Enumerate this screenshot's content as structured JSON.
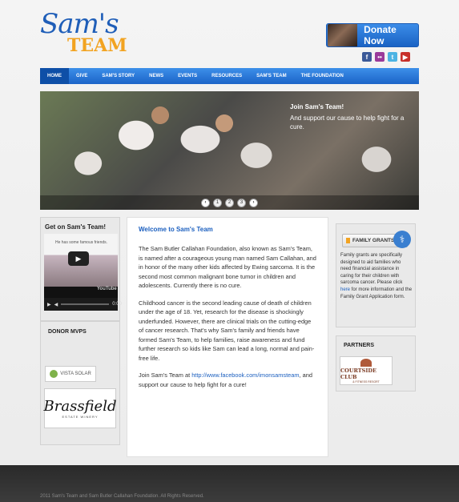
{
  "header": {
    "logo_script": "Sam's",
    "logo_team": "TEAM",
    "donate_label": "Donate Now",
    "social": [
      {
        "icon": "facebook-icon",
        "glyph": "f",
        "color": "#3b5998"
      },
      {
        "icon": "flickr-icon",
        "glyph": "••",
        "color": "#9a3a9a"
      },
      {
        "icon": "twitter-icon",
        "glyph": "t",
        "color": "#4cb3e3"
      },
      {
        "icon": "youtube-icon",
        "glyph": "▶",
        "color": "#c8302a"
      }
    ]
  },
  "nav": {
    "items": [
      "HOME",
      "GIVE",
      "SAM'S STORY",
      "NEWS",
      "EVENTS",
      "RESOURCES",
      "SAM'S TEAM",
      "THE FOUNDATION"
    ]
  },
  "slider": {
    "title": "Join Sam's Team!",
    "text": "And support our cause to help fight for a cure.",
    "prev": "‹",
    "next": "›",
    "pages": [
      "1",
      "2",
      "3"
    ]
  },
  "left": {
    "get_on_title": "Get on Sam's Team!",
    "video_caption": "He has some famous friends.",
    "video_yt": "YouTube",
    "video_time": "0:00",
    "donor_title": "DONOR MVPS",
    "sponsor1": "VISTA SOLAR",
    "sponsor2": "Brassfield",
    "sponsor2_sub": "ESTATE WINERY"
  },
  "main": {
    "title": "Welcome to Sam's Team",
    "p1": "The Sam Butler Callahan Foundation, also known as Sam's Team, is named after a courageous young man named Sam Callahan, and in honor of the many other kids affected by Ewing sarcoma. It is the second most common malignant bone tumor in children and adolescents. Currently there is no cure.",
    "p2": "Childhood cancer is the second leading cause of death of children under the age of 18. Yet, research for the disease is shockingly underfunded. However, there are clinical trials on the cutting-edge of cancer research. That's why Sam's family and friends have formed Sam's Team, to help families, raise awareness and fund further research so kids like Sam can lead a long, normal and pain-free life.",
    "p3_prefix": "Join Sam's Team at ",
    "p3_link": "http://www.facebook.com/imonsamsteam",
    "p3_suffix": ", and support our cause to help fight for a cure!"
  },
  "right": {
    "grants_label": "FAMILY GRANTS",
    "grants_text_prefix": "Family grants are specifically designed to aid families who need financial assistance in caring for their children with sarcoma cancer.  Please click ",
    "grants_link": "here",
    "grants_text_suffix": " for more information and the Family Grant Application form.",
    "partners_title": "PARTNERS",
    "partner1": "COURTSIDE CLUB",
    "partner1_sub": "& FITNESS RESORT"
  },
  "footer": {
    "copyright": "2011 Sam's Team and Sam Butler Callahan Foundation. All Rights Reserved."
  },
  "colors": {
    "brand_blue": "#1f5eb8",
    "brand_orange": "#f2a321",
    "nav_blue": "#1b64c8"
  }
}
